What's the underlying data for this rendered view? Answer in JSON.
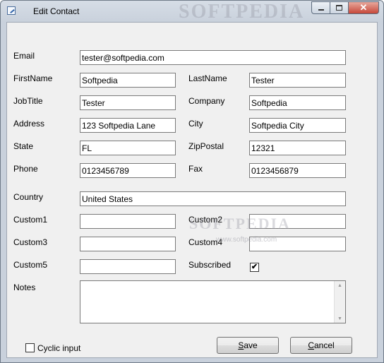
{
  "window": {
    "title": "Edit Contact",
    "watermark": "SOFTPEDIA",
    "watermark_url": "www.softpedia.com",
    "controls": {
      "minimize": "minimize-icon",
      "maximize": "maximize-icon",
      "close": "close-icon"
    }
  },
  "form": {
    "email": {
      "label": "Email",
      "value": "tester@softpedia.com"
    },
    "firstname": {
      "label": "FirstName",
      "value": "Softpedia"
    },
    "lastname": {
      "label": "LastName",
      "value": "Tester"
    },
    "jobtitle": {
      "label": "JobTitle",
      "value": "Tester"
    },
    "company": {
      "label": "Company",
      "value": "Softpedia"
    },
    "address": {
      "label": "Address",
      "value": "123 Softpedia Lane"
    },
    "city": {
      "label": "City",
      "value": "Softpedia City"
    },
    "state": {
      "label": "State",
      "value": "FL"
    },
    "zippostal": {
      "label": "ZipPostal",
      "value": "12321"
    },
    "phone": {
      "label": "Phone",
      "value": "0123456789"
    },
    "fax": {
      "label": "Fax",
      "value": "0123456879"
    },
    "country": {
      "label": "Country",
      "value": "United States"
    },
    "custom1": {
      "label": "Custom1",
      "value": ""
    },
    "custom2": {
      "label": "Custom2",
      "value": ""
    },
    "custom3": {
      "label": "Custom3",
      "value": ""
    },
    "custom4": {
      "label": "Custom4",
      "value": ""
    },
    "custom5": {
      "label": "Custom5",
      "value": ""
    },
    "subscribed": {
      "label": "Subscribed",
      "checked": true,
      "mark": "✔"
    },
    "notes": {
      "label": "Notes",
      "value": ""
    }
  },
  "footer": {
    "cyclic_input": {
      "label": "Cyclic input",
      "checked": false
    },
    "save": {
      "label_prefix": "",
      "mnemonic": "S",
      "label_suffix": "ave"
    },
    "cancel": {
      "label_prefix": "",
      "mnemonic": "C",
      "label_suffix": "ancel"
    }
  }
}
